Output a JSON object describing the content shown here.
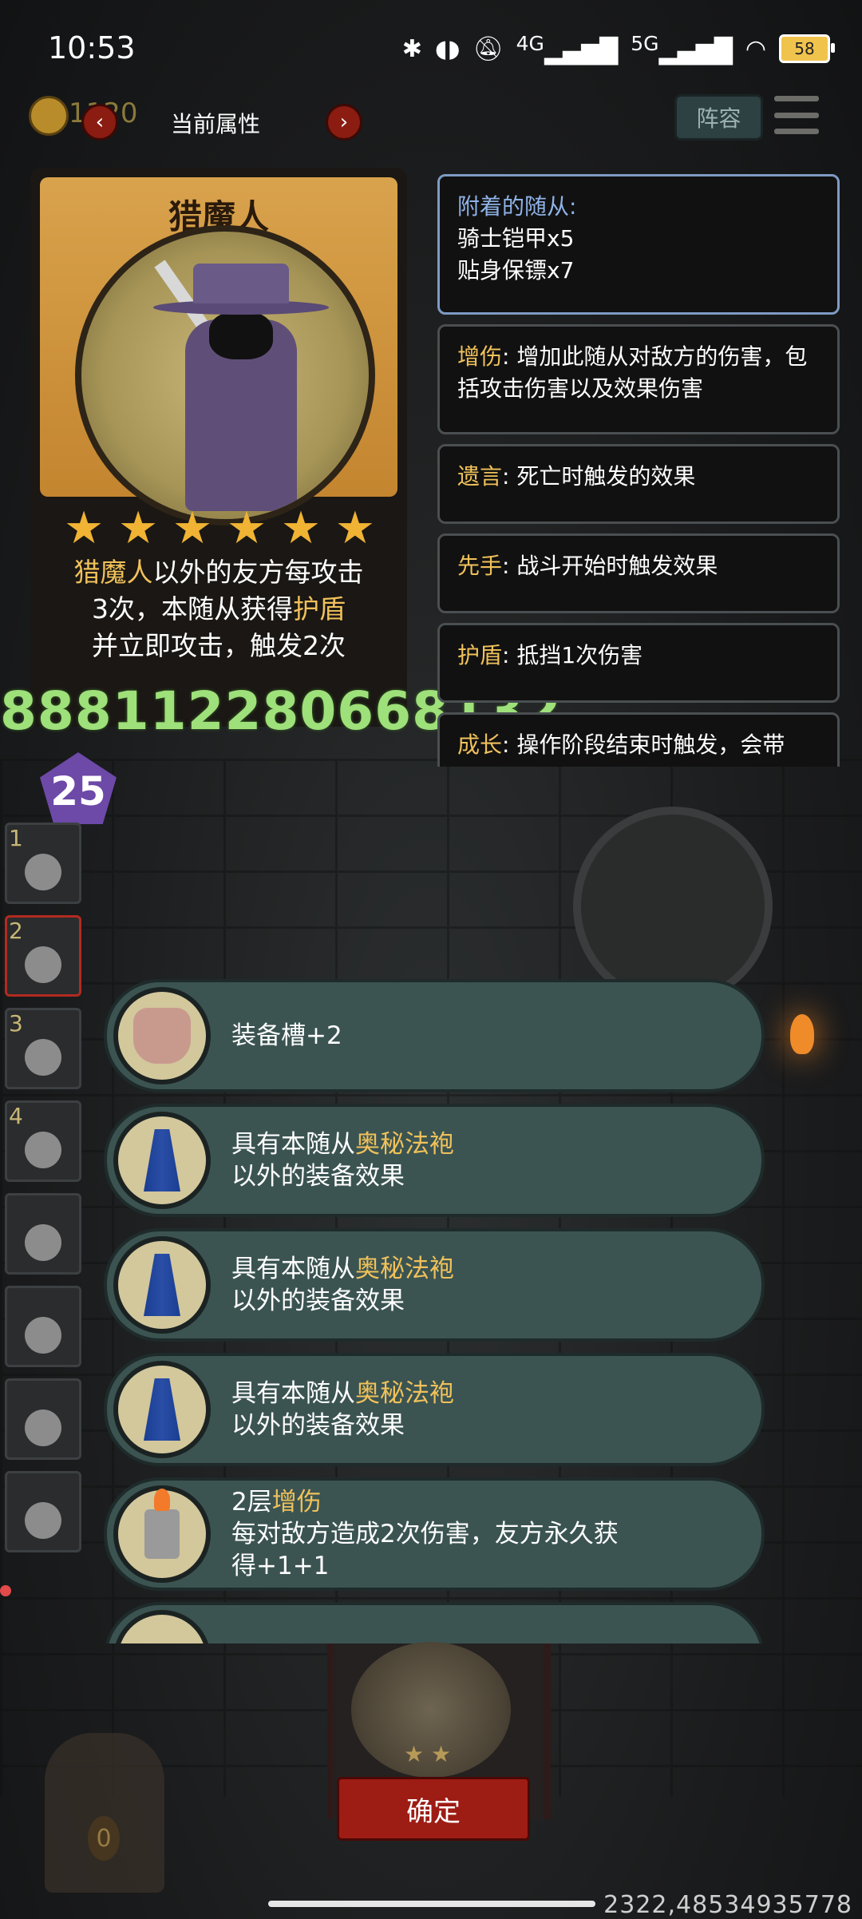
{
  "status_bar": {
    "time": "10:53",
    "network_1": "4G",
    "network_2": "5G",
    "battery": "58"
  },
  "top_bar": {
    "coin_value": "1120",
    "title": "当前属性",
    "prev": "‹",
    "next": "›",
    "lineup_button": "阵容"
  },
  "hero_card": {
    "name": "猎魔人",
    "stars": 6,
    "desc_part1": "猎魔人",
    "desc_part2": "以外的友方每攻击",
    "desc_line2a": "3次，本随从获得",
    "desc_line2b": "护盾",
    "desc_line3": "并立即攻击，触发2次"
  },
  "ticker": "888112280668132",
  "keywords": {
    "attached_title": "附着的随从:",
    "attached_1": "骑士铠甲x5",
    "attached_2": "贴身保镖x7",
    "items": [
      {
        "key": "增伤",
        "text": ": 增加此随从对敌方的伤害，包括攻击伤害以及效果伤害"
      },
      {
        "key": "遗言",
        "text": ": 死亡时触发的效果"
      },
      {
        "key": "先手",
        "text": ": 战斗开始时触发效果"
      },
      {
        "key": "护盾",
        "text": ": 抵挡1次伤害"
      },
      {
        "key": "成长",
        "text": ": 操作阶段结束时触发，会带"
      }
    ]
  },
  "level": "25",
  "roster": [
    "1",
    "2",
    "3",
    "4"
  ],
  "options": [
    {
      "line1_pre": "装备槽+2",
      "line1_hl": "",
      "line2": "",
      "icon": "armor-icon"
    },
    {
      "line1_pre": "具有本随从",
      "line1_hl": "奥秘法袍",
      "line2": "以外的装备效果",
      "icon": "robe-icon"
    },
    {
      "line1_pre": "具有本随从",
      "line1_hl": "奥秘法袍",
      "line2": "以外的装备效果",
      "icon": "robe-icon"
    },
    {
      "line1_pre": "具有本随从",
      "line1_hl": "奥秘法袍",
      "line2": "以外的装备效果",
      "icon": "robe-icon"
    },
    {
      "line1_pre": "2层",
      "line1_hl": "增伤",
      "line2": "每对敌方造成2次伤害，友方永久获",
      "line3": "得+1+1",
      "icon": "lighter-icon"
    }
  ],
  "confirm": "确定",
  "chest_counter": "0",
  "coords": "2322,48534935778"
}
